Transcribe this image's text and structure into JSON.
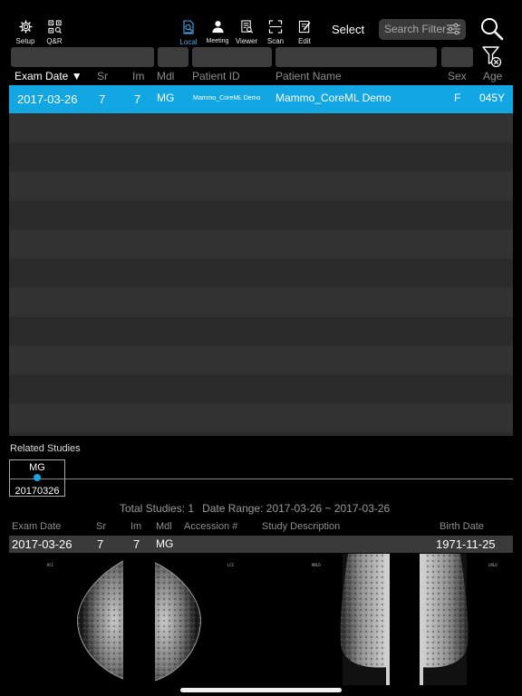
{
  "toolbar": {
    "setup": {
      "label": "Setup",
      "icon": "gear-icon"
    },
    "qr": {
      "label": "Q&R",
      "icon": "qr-search-icon"
    },
    "local": {
      "label": "Local",
      "icon": "local-search-icon"
    },
    "meeting": {
      "label": "Meeting",
      "icon": "person-icon"
    },
    "viewer": {
      "label": "Viewer",
      "icon": "viewer-icon"
    },
    "scan": {
      "label": "Scan",
      "icon": "scan-icon"
    },
    "edit": {
      "label": "Edit",
      "icon": "edit-icon"
    },
    "select_label": "Select",
    "search_filter": "Search Filter"
  },
  "columns": {
    "exam_date": "Exam Date ▼",
    "sr": "Sr",
    "im": "Im",
    "mdl": "Mdl",
    "patient_id": "Patient ID",
    "patient_name": "Patient Name",
    "sex": "Sex",
    "age": "Age"
  },
  "studies": [
    {
      "exam_date": "2017-03-26",
      "sr": "7",
      "im": "7",
      "mdl": "MG",
      "patient_id": "Mammo_CoreML Demo",
      "patient_name": "Mammo_CoreML Demo",
      "sex": "F",
      "age": "045Y"
    }
  ],
  "related": {
    "title": "Related Studies",
    "items": [
      {
        "modality": "MG",
        "date": "20170326"
      }
    ]
  },
  "summary": {
    "total": "Total Studies: 1",
    "range": "Date Range: 2017-03-26 ~ 2017-03-26"
  },
  "detail_columns": {
    "exam_date": "Exam Date",
    "sr": "Sr",
    "im": "Im",
    "mdl": "Mdl",
    "accession": "Accession #",
    "description": "Study Description",
    "birth_date": "Birth Date"
  },
  "detail": {
    "exam_date": "2017-03-26",
    "sr": "7",
    "im": "7",
    "mdl": "MG",
    "accession": "",
    "description": "",
    "birth_date": "1971-11-25"
  },
  "thumbnails": [
    {
      "view": "RCC"
    },
    {
      "view": "LCC"
    },
    {
      "view": "RMLO"
    },
    {
      "view": "LMLO"
    }
  ],
  "colors": {
    "accent": "#12a7e2",
    "background": "#000000",
    "list_bg": "#2f2f2f"
  }
}
